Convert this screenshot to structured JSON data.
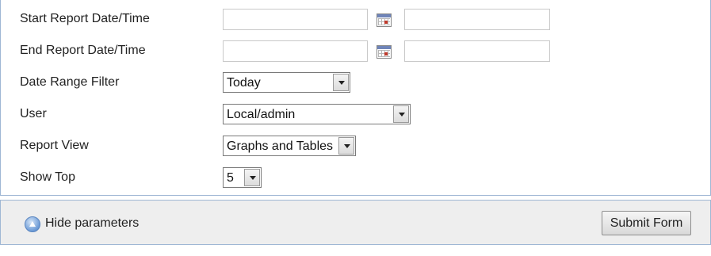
{
  "params": {
    "start_date": {
      "label": "Start Report Date/Time",
      "date_value": "",
      "time_value": "",
      "calendar_icon": "calendar-icon"
    },
    "end_date": {
      "label": "End Report Date/Time",
      "date_value": "",
      "time_value": "",
      "calendar_icon": "calendar-icon"
    },
    "date_range": {
      "label": "Date Range Filter",
      "selected": "Today"
    },
    "user": {
      "label": "User",
      "selected": "Local/admin"
    },
    "report_view": {
      "label": "Report View",
      "selected": "Graphs and Tables"
    },
    "show_top": {
      "label": "Show Top",
      "selected": "5"
    }
  },
  "footer": {
    "hide_icon": "collapse-up-icon",
    "hide_label": "Hide parameters",
    "submit_label": "Submit Form"
  },
  "colors": {
    "panel_border": "#9fb7d4",
    "footer_bg": "#eeeeee",
    "icon_blue": "#6b9ad6"
  }
}
